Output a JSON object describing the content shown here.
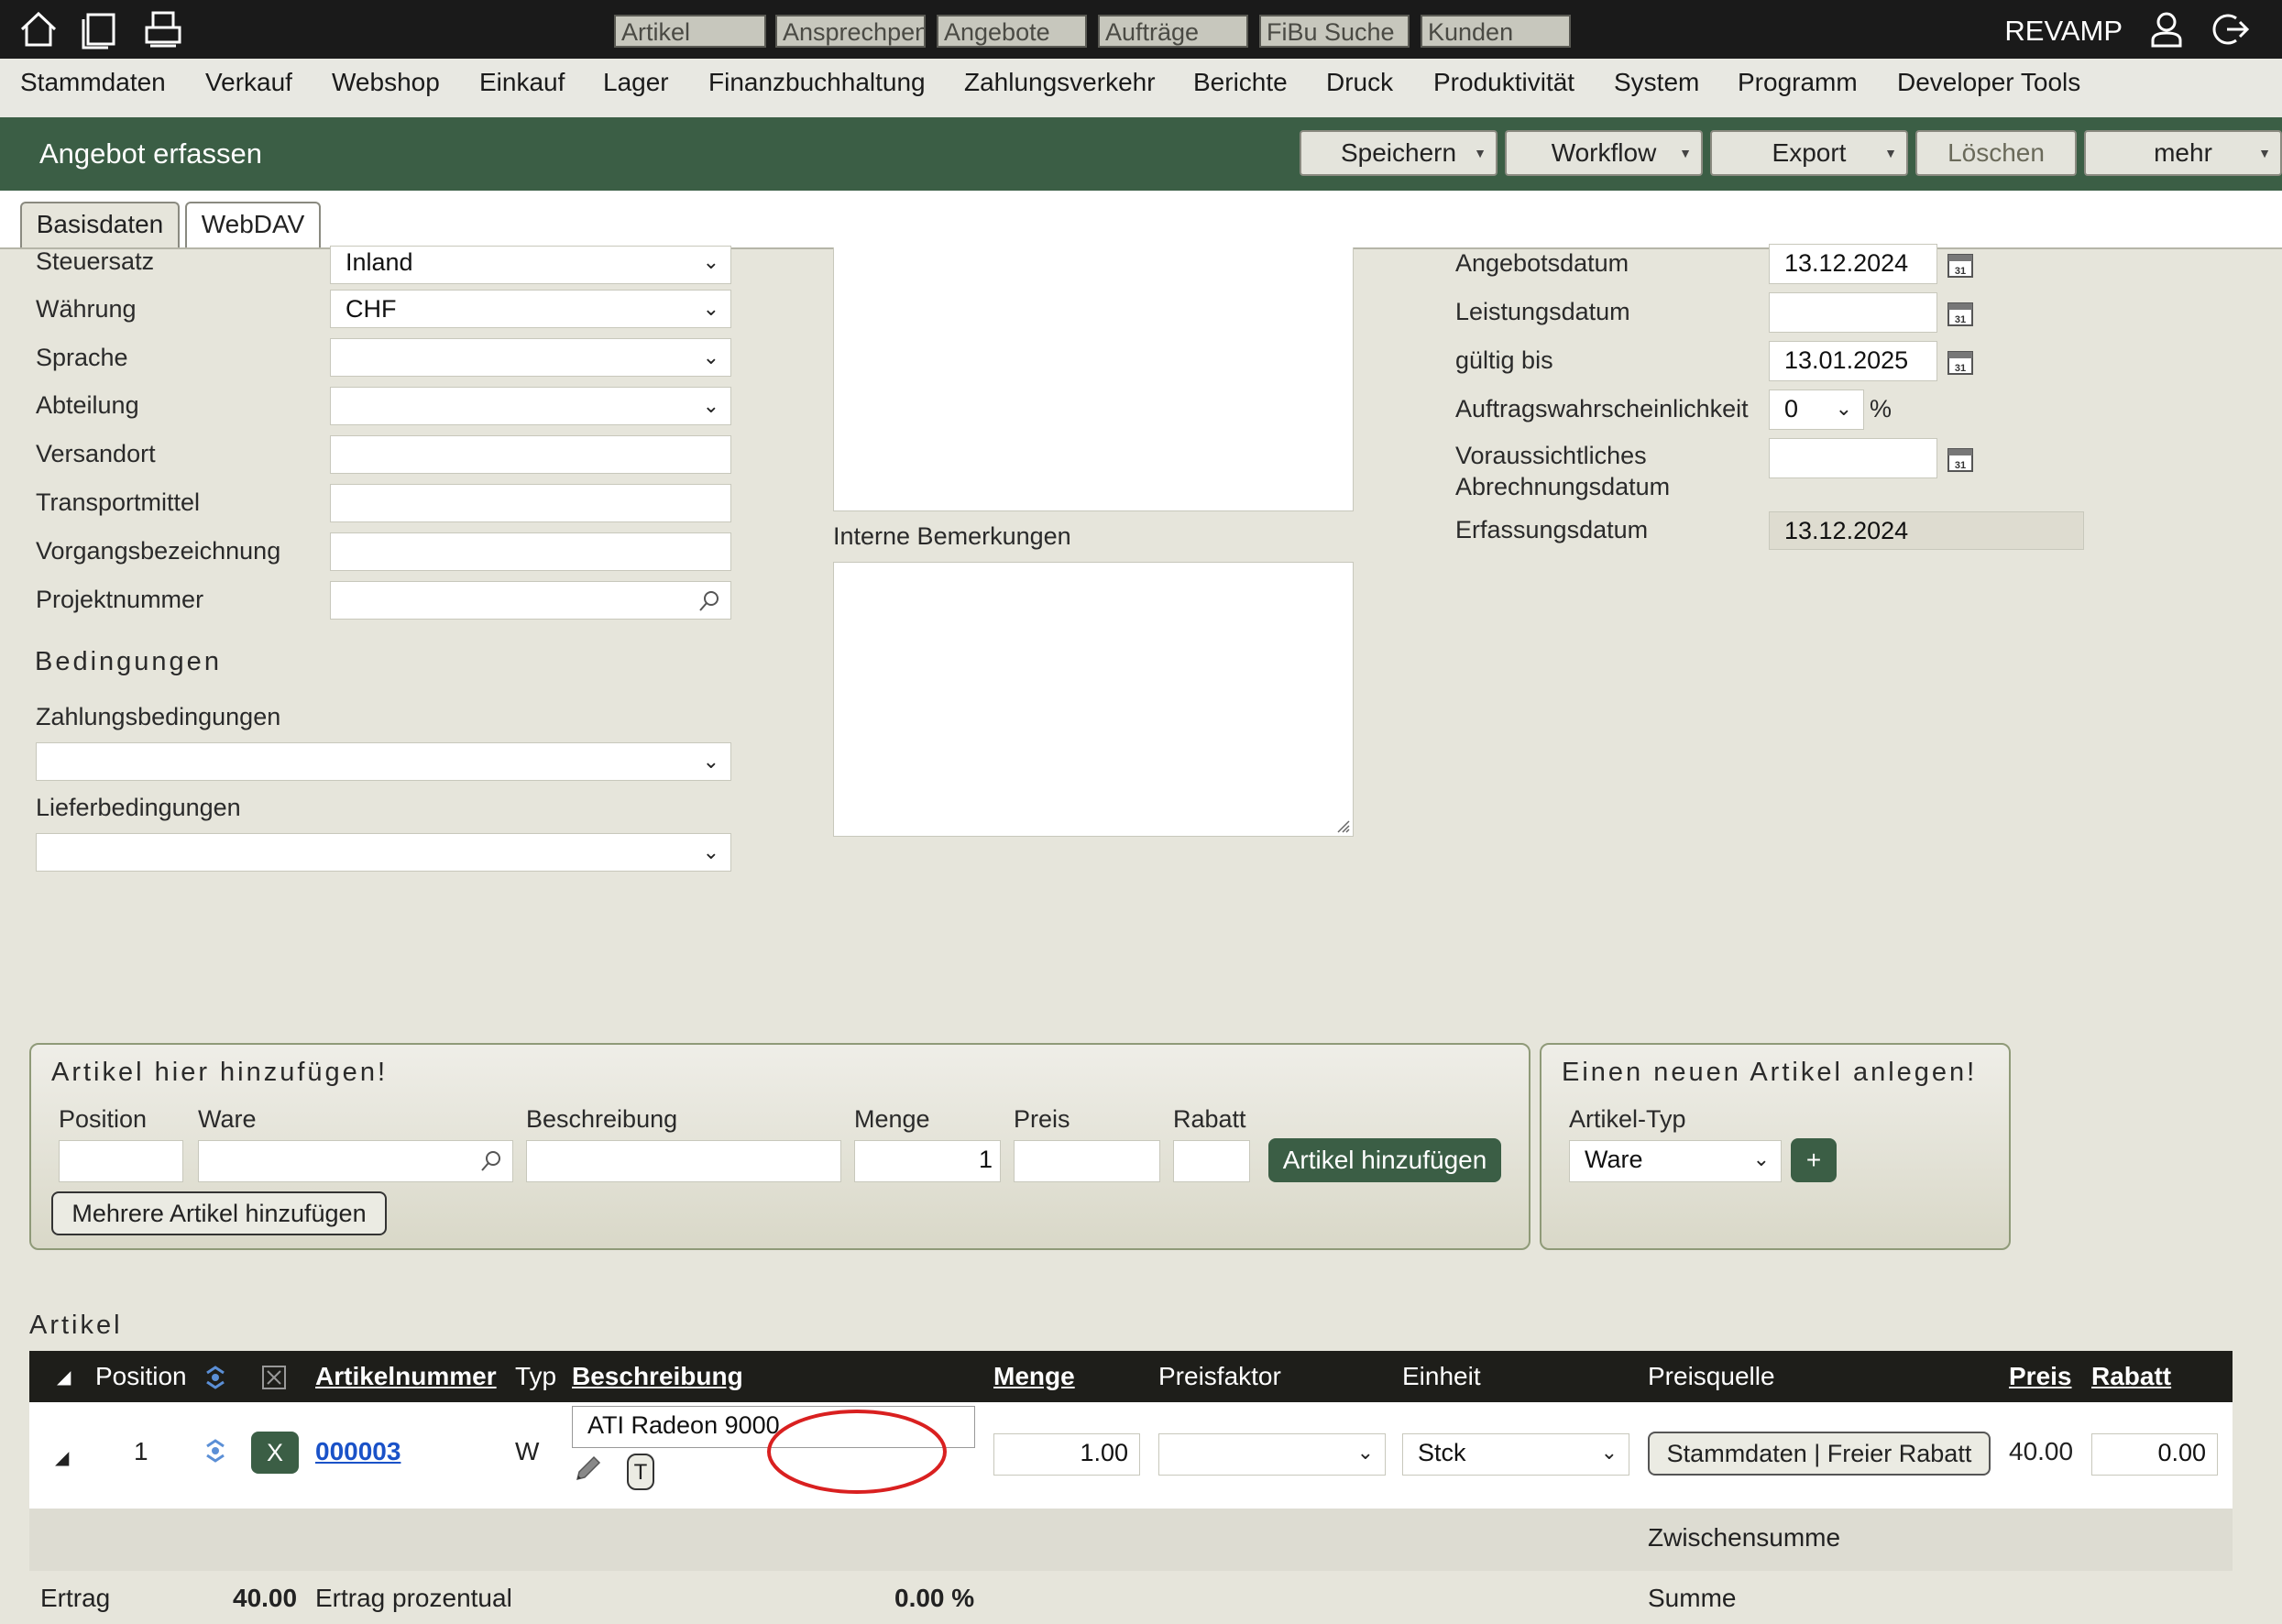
{
  "topbar": {
    "quick_search": [
      "Artikel",
      "Ansprechpen",
      "Angebote",
      "Aufträge",
      "FiBu Suche",
      "Kunden"
    ],
    "brand": "REVAMP"
  },
  "menu": [
    "Stammdaten",
    "Verkauf",
    "Webshop",
    "Einkauf",
    "Lager",
    "Finanzbuchhaltung",
    "Zahlungsverkehr",
    "Berichte",
    "Druck",
    "Produktivität",
    "System",
    "Programm",
    "Developer Tools"
  ],
  "titlebar": {
    "title": "Angebot erfassen",
    "buttons": [
      "Speichern",
      "Workflow",
      "Export",
      "Löschen",
      "mehr"
    ]
  },
  "tabs": [
    "Basisdaten",
    "WebDAV"
  ],
  "left_form": {
    "steuersatz": {
      "label": "Steuersatz",
      "value": "Inland"
    },
    "waehrung": {
      "label": "Währung",
      "value": "CHF"
    },
    "sprache": {
      "label": "Sprache",
      "value": ""
    },
    "abteilung": {
      "label": "Abteilung",
      "value": ""
    },
    "versandort": {
      "label": "Versandort",
      "value": ""
    },
    "transportmittel": {
      "label": "Transportmittel",
      "value": ""
    },
    "vorgangsbezeichnung": {
      "label": "Vorgangsbezeichnung",
      "value": ""
    },
    "projektnummer": {
      "label": "Projektnummer",
      "value": ""
    },
    "bedingungen_title": "Bedingungen",
    "zahlungsbedingungen": {
      "label": "Zahlungsbedingungen",
      "value": ""
    },
    "lieferbedingungen": {
      "label": "Lieferbedingungen",
      "value": ""
    }
  },
  "middle": {
    "interne_bemerkungen": "Interne Bemerkungen"
  },
  "right_form": {
    "angebotsdatum": {
      "label": "Angebotsdatum",
      "value": "13.12.2024"
    },
    "leistungsdatum": {
      "label": "Leistungsdatum",
      "value": ""
    },
    "gueltig_bis": {
      "label": "gültig bis",
      "value": "13.01.2025"
    },
    "auftragswahrscheinlichkeit": {
      "label": "Auftragswahrscheinlichkeit",
      "value": "0",
      "unit": "%"
    },
    "abrechnungsdatum": {
      "label_line1": "Voraussichtliches",
      "label_line2": "Abrechnungsdatum",
      "value": ""
    },
    "erfassungsdatum": {
      "label": "Erfassungsdatum",
      "value": "13.12.2024"
    }
  },
  "add_panel": {
    "title": "Artikel hier hinzufügen!",
    "labels": {
      "position": "Position",
      "ware": "Ware",
      "beschreibung": "Beschreibung",
      "menge": "Menge",
      "preis": "Preis",
      "rabatt": "Rabatt"
    },
    "menge_value": "1",
    "add_button": "Artikel hinzufügen",
    "multi_button": "Mehrere Artikel hinzufügen"
  },
  "new_panel": {
    "title": "Einen neuen Artikel anlegen!",
    "type_label": "Artikel-Typ",
    "type_value": "Ware",
    "plus": "+"
  },
  "articles": {
    "title": "Artikel",
    "headers": {
      "position": "Position",
      "artikelnummer": "Artikelnummer",
      "typ": "Typ",
      "beschreibung": "Beschreibung",
      "menge": "Menge",
      "preisfaktor": "Preisfaktor",
      "einheit": "Einheit",
      "preisquelle": "Preisquelle",
      "preis": "Preis",
      "rabatt": "Rabatt"
    },
    "row": {
      "position": "1",
      "delete": "X",
      "artikelnummer": "000003",
      "typ": "W",
      "beschreibung": "ATI Radeon 9000",
      "t_button": "T",
      "menge": "1.00",
      "preisfaktor": "",
      "einheit": "Stck",
      "preisquelle": "Stammdaten | Freier Rabatt",
      "preis": "40.00",
      "rabatt": "0.00"
    },
    "zwischensumme_label": "Zwischensumme",
    "ertrag_label": "Ertrag",
    "ertrag_value": "40.00",
    "ertrag_prozentual_label": "Ertrag prozentual",
    "ertrag_prozentual_value": "0.00 %",
    "summe_label": "Summe"
  },
  "colors": {
    "accent": "#3b5e45",
    "topbar": "#1a1a1a",
    "highlight_circle": "#d92020"
  }
}
